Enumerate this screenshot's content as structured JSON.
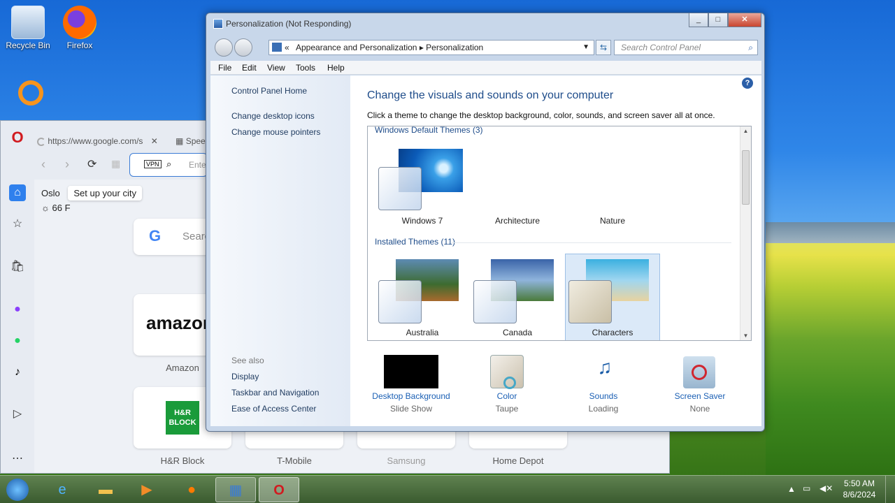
{
  "desktop": {
    "icons": [
      {
        "label": "Recycle Bin"
      },
      {
        "label": "Firefox"
      }
    ]
  },
  "opera": {
    "tab_url": "https://www.google.com/s",
    "tab2": "Spee",
    "address_placeholder": "Ente",
    "vpn": "VPN",
    "weather_city": "Oslo",
    "weather_tooltip": "Set up your city",
    "weather_temp": "66 F",
    "search_placeholder": "Searc",
    "tiles": [
      "Amazon",
      "H&R Block",
      "T-Mobile",
      "Samsung",
      "Home Depot"
    ],
    "amazon_logo": "amazon",
    "hr_logo": "H&R BLOCK"
  },
  "window": {
    "title": "Personalization (Not Responding)",
    "breadcrumb": [
      "Appearance and Personalization",
      "Personalization"
    ],
    "search_placeholder": "Search Control Panel",
    "menu": [
      "File",
      "Edit",
      "View",
      "Tools",
      "Help"
    ],
    "left_links": [
      "Control Panel Home",
      "Change desktop icons",
      "Change mouse pointers"
    ],
    "see_also_title": "See also",
    "see_also": [
      "Display",
      "Taskbar and Navigation",
      "Ease of Access Center"
    ],
    "heading": "Change the visuals and sounds on your computer",
    "subheading": "Click a theme to change the desktop background, color, sounds, and screen saver all at once.",
    "groups": [
      {
        "title": "Windows Default Themes (3)",
        "themes": [
          "Windows 7",
          "Architecture",
          "Nature"
        ]
      },
      {
        "title": "Installed Themes (11)",
        "themes": [
          "Australia",
          "Canada",
          "Characters"
        ]
      }
    ],
    "bottom": [
      {
        "label": "Desktop Background",
        "sub": "Slide Show"
      },
      {
        "label": "Color",
        "sub": "Taupe"
      },
      {
        "label": "Sounds",
        "sub": "Loading"
      },
      {
        "label": "Screen Saver",
        "sub": "None"
      }
    ]
  },
  "taskbar": {
    "time": "5:50 AM",
    "date": "8/6/2024"
  }
}
